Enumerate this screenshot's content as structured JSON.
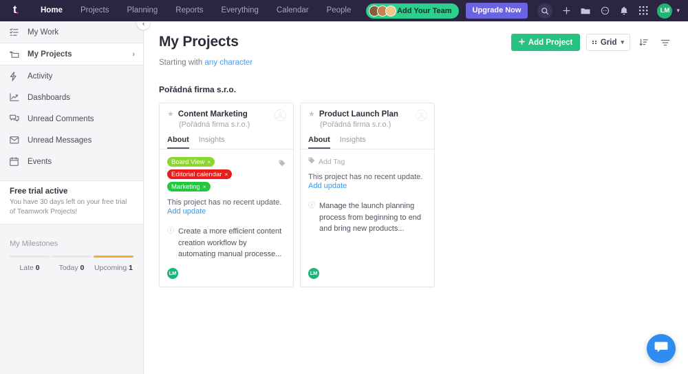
{
  "topbar": {
    "logo": "t",
    "nav": [
      {
        "label": "Home",
        "active": true
      },
      {
        "label": "Projects",
        "active": false
      },
      {
        "label": "Planning",
        "active": false
      },
      {
        "label": "Reports",
        "active": false
      },
      {
        "label": "Everything",
        "active": false
      },
      {
        "label": "Calendar",
        "active": false
      },
      {
        "label": "People",
        "active": false
      }
    ],
    "add_team_label": "Add Your Team",
    "upgrade_label": "Upgrade Now",
    "icons": [
      "search-icon",
      "plus-icon",
      "folder-icon",
      "chat-icon",
      "bell-icon",
      "apps-grid-icon"
    ],
    "user_initials": "LM",
    "accent_green": "#2ad08c",
    "accent_purple": "#6c63e0",
    "bar_background": "#2b2542"
  },
  "sidebar": {
    "items": [
      {
        "label": "My Work",
        "icon": "checklist-icon",
        "selected": false
      },
      {
        "label": "My Projects",
        "icon": "folder-icon",
        "selected": true,
        "chevron": "›"
      },
      {
        "label": "Activity",
        "icon": "bolt-icon",
        "selected": false
      },
      {
        "label": "Dashboards",
        "icon": "chart-icon",
        "selected": false
      },
      {
        "label": "Unread Comments",
        "icon": "comments-icon",
        "selected": false
      },
      {
        "label": "Unread Messages",
        "icon": "envelope-icon",
        "selected": false
      },
      {
        "label": "Events",
        "icon": "calendar-icon",
        "selected": false
      }
    ],
    "collapse_icon": "‹",
    "trial": {
      "title": "Free trial active",
      "text": "You have 30 days left on your free trial of Teamwork Projects!"
    },
    "milestones": {
      "title": "My Milestones",
      "segments": [
        {
          "label": "Late",
          "count": "0",
          "highlight": false
        },
        {
          "label": "Today",
          "count": "0",
          "highlight": false
        },
        {
          "label": "Upcoming",
          "count": "1",
          "highlight": true
        }
      ],
      "highlight_color": "#f7a93b"
    }
  },
  "main": {
    "title": "My Projects",
    "subline_prefix": "Starting with ",
    "subline_link": "any character",
    "group_title": "Pořádná firma s.r.o.",
    "add_project_label": "Add Project",
    "view_label": "Grid",
    "sort_icon": "sort-icon",
    "filter_icon": "filter-icon",
    "add_project_color": "#27c281"
  },
  "cards": [
    {
      "title": "Content Marketing",
      "company": "(Pořádná firma s.r.o.)",
      "tabs": [
        {
          "label": "About",
          "active": true
        },
        {
          "label": "Insights",
          "active": false
        }
      ],
      "tags": [
        {
          "label": "Board View",
          "color": "#8cd633",
          "close": "×"
        },
        {
          "label": "Editorial calendar",
          "color": "#e81d1d",
          "close": "×"
        },
        {
          "label": "Marketing",
          "color": "#22c93f",
          "close": "×"
        }
      ],
      "add_tag_label": null,
      "no_update_text": "This project has no recent update.",
      "add_update_label": "Add update",
      "description": "Create a more efficient content creation workflow by automating manual processe...",
      "member_initials": "LM"
    },
    {
      "title": "Product Launch Plan",
      "company": "(Pořádná firma s.r.o.)",
      "tabs": [
        {
          "label": "About",
          "active": true
        },
        {
          "label": "Insights",
          "active": false
        }
      ],
      "tags": [],
      "add_tag_label": "Add Tag",
      "no_update_text": "This project has no recent update.",
      "add_update_label": "Add update",
      "description": "Manage the launch planning process from beginning to end and bring new products...",
      "member_initials": "LM"
    }
  ],
  "chat_widget": {
    "icon": "chat-bubble-icon",
    "color": "#2f8cf0"
  }
}
